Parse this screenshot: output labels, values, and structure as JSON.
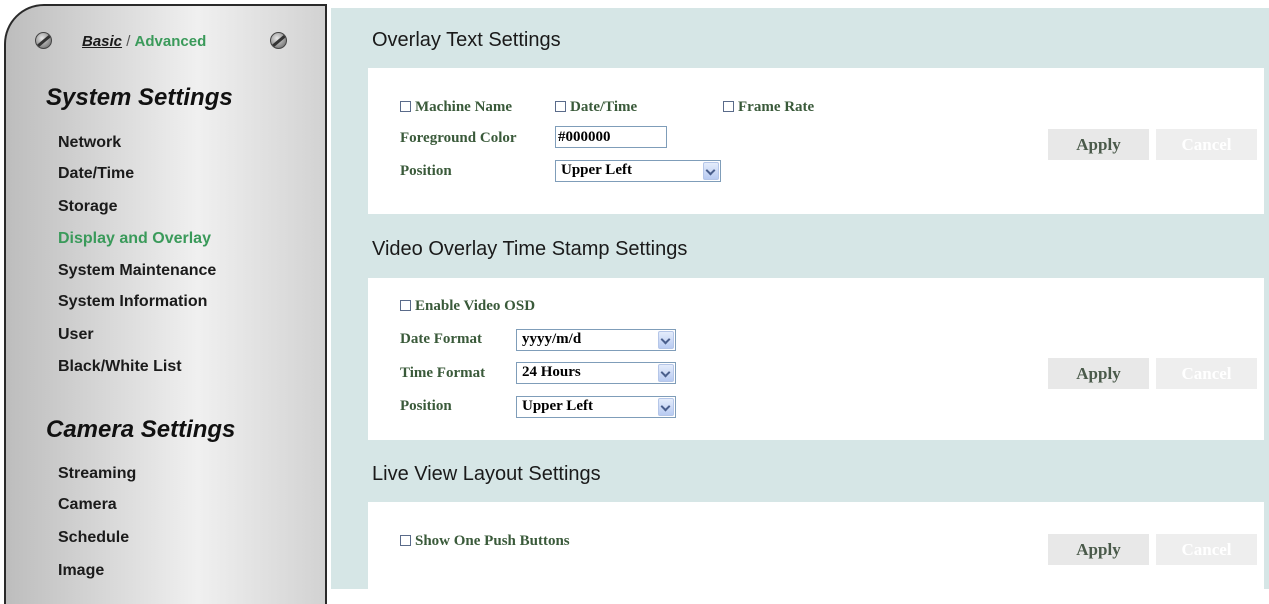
{
  "mode_switch": {
    "basic": "Basic",
    "separator": " / ",
    "advanced": "Advanced"
  },
  "sidebar": {
    "system_title": "System Settings",
    "system_items": [
      "Network",
      "Date/Time",
      "Storage",
      "Display and Overlay",
      "System Maintenance",
      "System Information",
      "User",
      "Black/White List"
    ],
    "active_item": "Display and Overlay",
    "camera_title": "Camera Settings",
    "camera_items": [
      "Streaming",
      "Camera",
      "Schedule",
      "Image"
    ]
  },
  "overlay_text": {
    "title": "Overlay Text Settings",
    "machine_name": "Machine Name",
    "date_time": "Date/Time",
    "frame_rate": "Frame Rate",
    "fg_color_label": "Foreground Color",
    "fg_color_value": "#000000",
    "position_label": "Position",
    "position_value": "Upper Left"
  },
  "video_overlay": {
    "title": "Video Overlay Time Stamp Settings",
    "enable_osd": "Enable Video OSD",
    "date_format_label": "Date Format",
    "date_format_value": "yyyy/m/d",
    "time_format_label": "Time Format",
    "time_format_value": "24 Hours",
    "position_label": "Position",
    "position_value": "Upper Left"
  },
  "live_view": {
    "title": "Live View Layout Settings",
    "show_one_push": "Show One Push Buttons"
  },
  "buttons": {
    "apply": "Apply",
    "cancel": "Cancel"
  }
}
